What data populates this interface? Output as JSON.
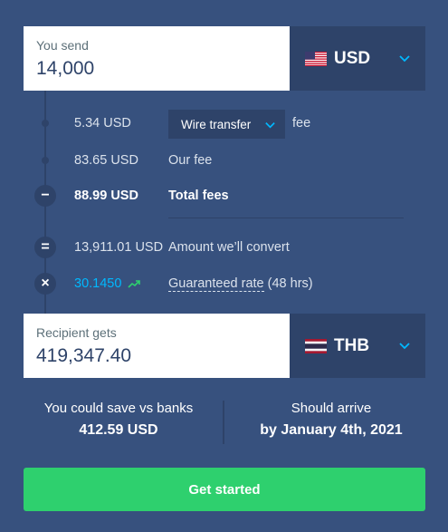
{
  "send": {
    "label": "You send",
    "value": "14,000",
    "currency": "USD",
    "flag_icon": "us-flag-icon"
  },
  "fees": {
    "transfer_fee_amount": "5.34 USD",
    "transfer_method": "Wire transfer",
    "fee_word": "fee",
    "our_fee_amount": "83.65 USD",
    "our_fee_label": "Our fee",
    "total_fees_amount": "88.99 USD",
    "total_fees_label": "Total fees",
    "convert_amount": "13,911.01 USD",
    "convert_label": "Amount we’ll convert",
    "rate_value": "30.1450",
    "rate_link": "Guaranteed rate",
    "rate_suffix": " (48 hrs)"
  },
  "receive": {
    "label": "Recipient gets",
    "value": "419,347.40",
    "currency": "THB",
    "flag_icon": "th-flag-icon"
  },
  "savings": {
    "label": "You could save vs banks",
    "value": "412.59 USD"
  },
  "arrival": {
    "label": "Should arrive",
    "value": "by January 4th, 2021"
  },
  "cta_label": "Get started",
  "colors": {
    "background": "#37517e",
    "panel": "#2e4369",
    "accent_blue": "#00b9ff",
    "rate_trend": "#2ed06e",
    "cta": "#2ed06e"
  }
}
